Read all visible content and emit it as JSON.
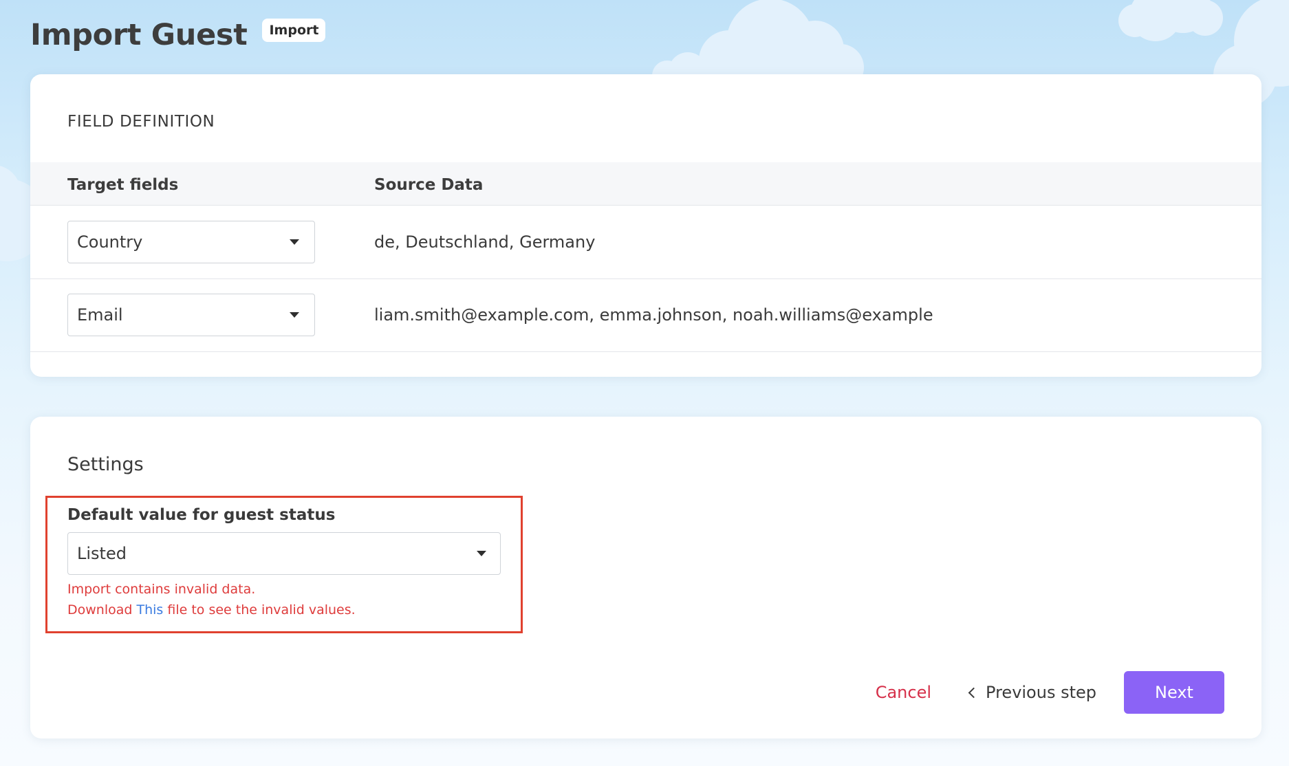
{
  "header": {
    "title": "Import Guest",
    "badge": "Import"
  },
  "field_definition": {
    "heading": "FIELD DEFINITION",
    "columns": {
      "target": "Target fields",
      "source": "Source Data"
    },
    "rows": [
      {
        "target": "Country",
        "source": "de, Deutschland, Germany"
      },
      {
        "target": "Email",
        "source": "liam.smith@example.com, emma.johnson, noah.williams@example"
      }
    ]
  },
  "settings": {
    "title": "Settings",
    "status_label": "Default value for guest status",
    "status_value": "Listed",
    "error_line_1": "Import contains invalid data.",
    "error_prefix": "Download ",
    "error_link": "This",
    "error_suffix": " file to see the invalid values."
  },
  "actions": {
    "cancel": "Cancel",
    "previous": "Previous step",
    "next": "Next"
  },
  "colors": {
    "accent": "#8b63f6",
    "error": "#de3b3b",
    "cancel": "#d6304a",
    "link": "#3a7be0",
    "highlight": "#e0412f"
  },
  "icons": {
    "dropdown": "caret-down-icon",
    "previous": "chevron-left-icon"
  }
}
